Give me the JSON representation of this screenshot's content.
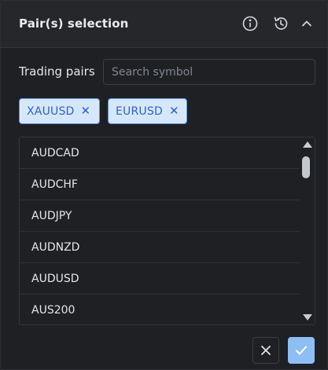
{
  "header": {
    "title": "Pair(s) selection",
    "info_icon": "info-icon",
    "history_icon": "history-icon",
    "collapse_icon": "chevron-up-icon"
  },
  "trading_pairs": {
    "label": "Trading pairs",
    "search_placeholder": "Search symbol",
    "search_value": ""
  },
  "selected_chips": [
    {
      "label": "XAUUSD",
      "remove_icon": "close-icon"
    },
    {
      "label": "EURUSD",
      "remove_icon": "close-icon"
    }
  ],
  "symbol_list": [
    "AUDCAD",
    "AUDCHF",
    "AUDJPY",
    "AUDNZD",
    "AUDUSD",
    "AUS200"
  ],
  "footer": {
    "cancel_icon": "close-icon",
    "confirm_icon": "check-icon"
  },
  "colors": {
    "panel_bg": "#1f2023",
    "header_bg": "#26272b",
    "chip_bg": "#d7e7fb",
    "chip_text": "#2e63c8",
    "confirm_bg": "#8dbff5"
  }
}
